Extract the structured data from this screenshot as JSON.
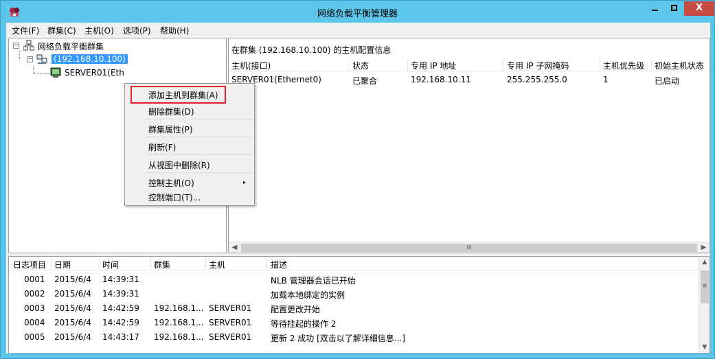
{
  "window": {
    "title": "网络负载平衡管理器",
    "accent": "#5bc6ea",
    "close_color": "#c74b43",
    "minimize_symbol": "_",
    "maximize_symbol": "□",
    "close_symbol": "X"
  },
  "menu": {
    "file": "文件(F)",
    "cluster": "群集(C)",
    "host": "主机(O)",
    "options": "选项(P)",
    "help": "帮助(H)"
  },
  "tree": {
    "root": "网络负载平衡群集",
    "cluster": "(192.168.10.100)",
    "host": "SERVER01(Eth"
  },
  "right_pane": {
    "header": "在群集 (192.168.10.100) 的主机配置信息",
    "columns": [
      "主机(接口)",
      "状态",
      "专用 IP 地址",
      "专用 IP 子网掩码",
      "主机优先级",
      "初始主机状态"
    ],
    "rows": [
      [
        "SERVER01(Ethernet0)",
        "已聚合",
        "192.168.10.11",
        "255.255.255.0",
        "1",
        "已启动"
      ]
    ],
    "scroll_thumb": "III"
  },
  "context_menu": {
    "items": [
      "添加主机到群集(A)",
      "删除群集(D)",
      "群集属性(P)",
      "刷新(F)",
      "从视图中删除(R)",
      "控制主机(O)",
      "控制端口(T)..."
    ],
    "submenu_arrow": "▸",
    "highlight_color": "#e0202a"
  },
  "log": {
    "columns": [
      "日志项目",
      "日期",
      "时间",
      "群集",
      "主机",
      "描述"
    ],
    "rows": [
      [
        "0001",
        "2015/6/4",
        "14:39:31",
        "",
        "",
        "NLB 管理器会话已开始"
      ],
      [
        "0002",
        "2015/6/4",
        "14:39:31",
        "",
        "",
        "加载本地绑定的实例"
      ],
      [
        "0003",
        "2015/6/4",
        "14:42:59",
        "192.168.1...",
        "SERVER01",
        "配置更改开始"
      ],
      [
        "0004",
        "2015/6/4",
        "14:42:59",
        "192.168.1...",
        "SERVER01",
        "等待挂起的操作 2"
      ],
      [
        "0005",
        "2015/6/4",
        "14:43:17",
        "192.168.1...",
        "SERVER01",
        "更新 2 成功 [双击以了解详细信息...]"
      ]
    ],
    "scroll_thumb": "≡"
  }
}
